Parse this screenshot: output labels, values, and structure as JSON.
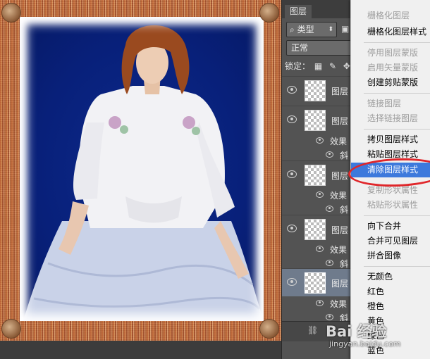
{
  "panel": {
    "tab_label": "图层",
    "filter_label": "类型",
    "filter_prefix_icon": "search-icon",
    "blend_mode": "正常",
    "lock_label": "锁定："
  },
  "layers": [
    {
      "name": "图层",
      "selected": false,
      "effects": []
    },
    {
      "name": "图层",
      "selected": false,
      "effects": [
        "效果",
        "斜"
      ]
    },
    {
      "name": "图层",
      "selected": false,
      "effects": [
        "效果",
        "斜"
      ]
    },
    {
      "name": "图层",
      "selected": false,
      "effects": [
        "效果",
        "斜"
      ]
    },
    {
      "name": "图层",
      "selected": true,
      "effects": [
        "效果",
        "斜"
      ]
    }
  ],
  "menu": {
    "items": [
      {
        "label": "栅格化图层",
        "disabled": true
      },
      {
        "label": "栅格化图层样式",
        "disabled": false
      },
      {
        "label": "停用图层蒙版",
        "disabled": true
      },
      {
        "label": "启用矢量蒙版",
        "disabled": true
      },
      {
        "label": "创建剪贴蒙版",
        "disabled": false
      },
      {
        "label": "链接图层",
        "disabled": true
      },
      {
        "label": "选择链接图层",
        "disabled": true
      },
      {
        "label": "拷贝图层样式",
        "disabled": false
      },
      {
        "label": "粘贴图层样式",
        "disabled": false
      },
      {
        "label": "清除图层样式",
        "disabled": false,
        "highlighted": true
      },
      {
        "label": "复制形状属性",
        "disabled": true
      },
      {
        "label": "粘贴形状属性",
        "disabled": true
      },
      {
        "label": "向下合并",
        "disabled": false
      },
      {
        "label": "合并可见图层",
        "disabled": false
      },
      {
        "label": "拼合图像",
        "disabled": false
      },
      {
        "label": "无颜色",
        "disabled": false
      },
      {
        "label": "红色",
        "disabled": false
      },
      {
        "label": "橙色",
        "disabled": false
      },
      {
        "label": "黄色",
        "disabled": false
      },
      {
        "label": "绿色",
        "disabled": false
      },
      {
        "label": "蓝色",
        "disabled": false
      }
    ],
    "highlight_color": "#3d79dc",
    "annotation_color": "#e0262a"
  },
  "watermark": {
    "logo": "Bai 经验",
    "url": "jingyan.baidu.com"
  }
}
